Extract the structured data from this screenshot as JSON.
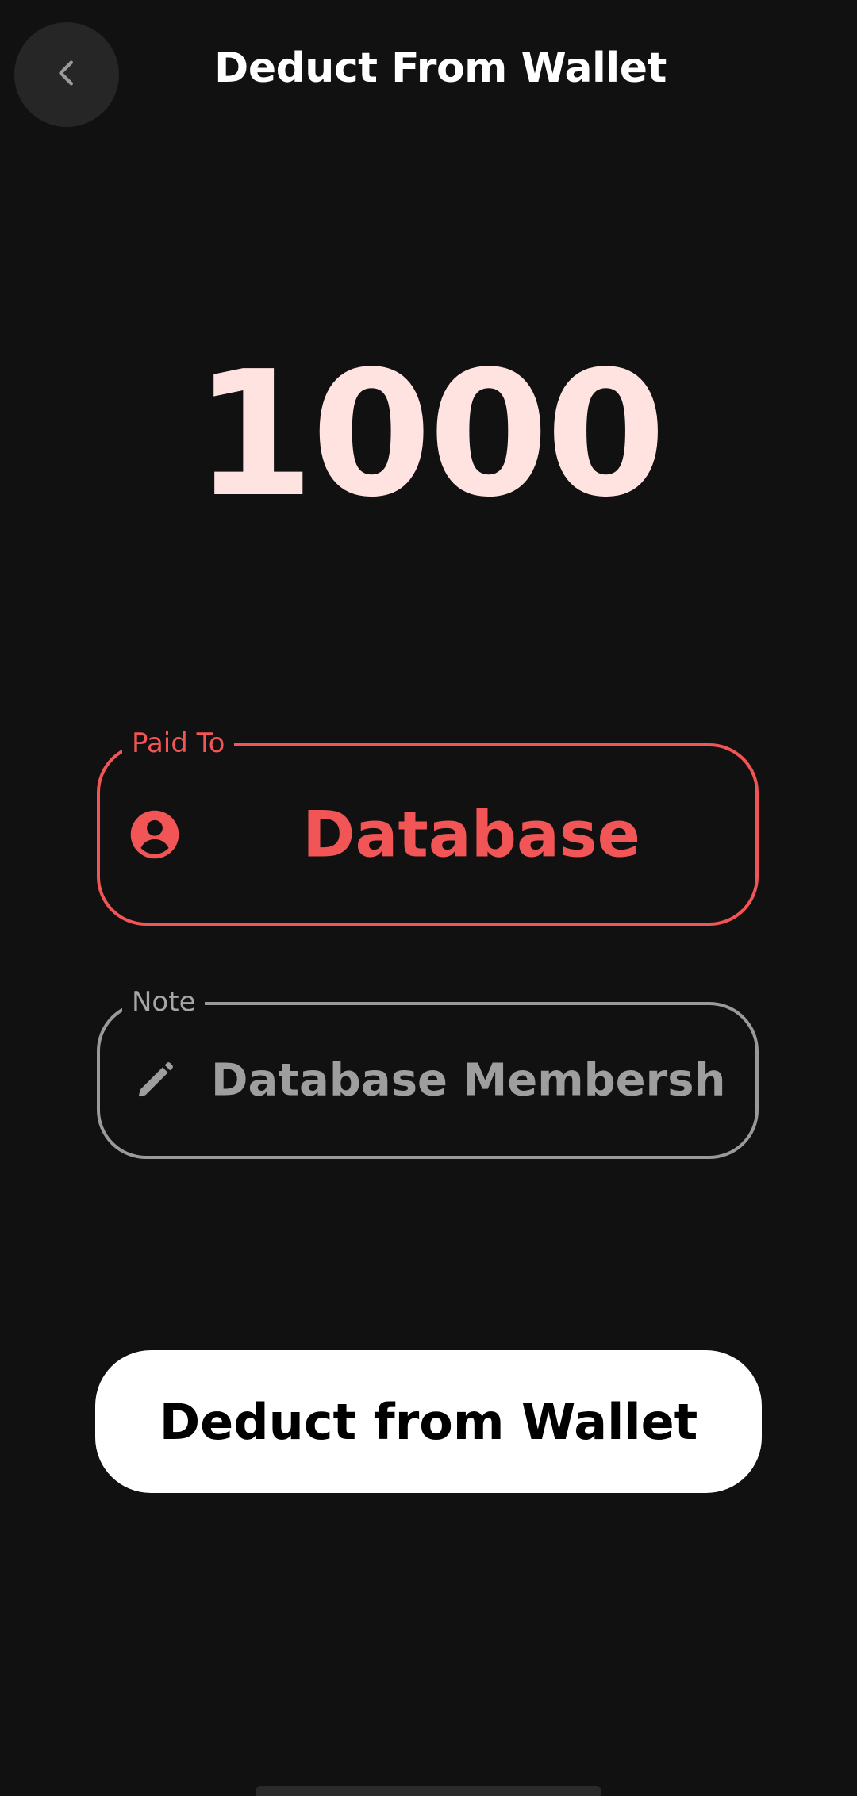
{
  "header": {
    "title": "Deduct From Wallet",
    "back_icon": "chevron-left-icon"
  },
  "amount": {
    "value": "1000",
    "color": "#ffe3e1"
  },
  "paid_to": {
    "label": "Paid To",
    "value": "Database",
    "icon": "account-circle-icon",
    "accent": "#f25555"
  },
  "note": {
    "label": "Note",
    "value": "Database Membership",
    "icon": "pencil-icon"
  },
  "actions": {
    "submit_label": "Deduct from Wallet"
  }
}
